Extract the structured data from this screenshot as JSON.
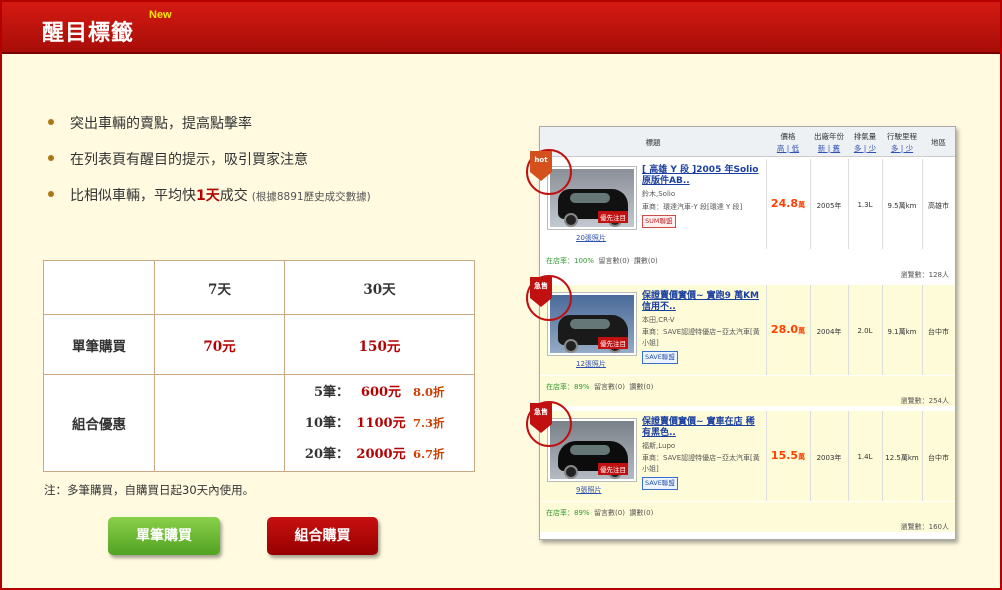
{
  "header": {
    "title": "醒目標籤",
    "new_badge": "New"
  },
  "bullets": [
    {
      "text": "突出車輛的賣點，提高點擊率"
    },
    {
      "text": "在列表頁有醒目的提示，吸引買家注意"
    },
    {
      "pre": "比相似車輛，平均快",
      "highlight": "1天",
      "post": "成交",
      "note": "(根據8891歷史成交數據)"
    }
  ],
  "pricing": {
    "col_7": "7天",
    "col_30": "30天",
    "single_label": "單筆購買",
    "single_7": "70元",
    "single_30": "150元",
    "combo_label": "組合優惠",
    "combos": [
      {
        "qty": "5筆：",
        "price": "600元",
        "discount": "8.0折"
      },
      {
        "qty": "10筆：",
        "price": "1100元",
        "discount": "7.3折"
      },
      {
        "qty": "20筆：",
        "price": "2000元",
        "discount": "6.7折"
      }
    ]
  },
  "note": "注：多筆購買，自購買日起30天內使用。",
  "buttons": {
    "single": "單筆購買",
    "combo": "組合購買"
  },
  "listing": {
    "headers": {
      "title": "標題",
      "price": "價格",
      "price_sort": "高 | 低",
      "year": "出廠年份",
      "year_sort": "新 | 舊",
      "disp": "排氣量",
      "disp_sort": "多 | 少",
      "mileage": "行駛里程",
      "mileage_sort": "多 | 少",
      "area": "地區"
    },
    "rows": [
      {
        "tag": "hot",
        "title": "[ 高雄 Y 段 ]2005 年Solio 原版件AB..",
        "model": "鈴木,Solio",
        "dealer": "車商：環達汽車-Y 段[環達 Y 段]",
        "badge": "SUM聯盟",
        "photos": "20張照片",
        "photo_tag": "優先注目",
        "price": "24.8",
        "unit": "萬",
        "year": "2005年",
        "disp": "1.3L",
        "mileage": "9.5萬km",
        "area": "高雄市",
        "foot_a": "在店率：100%",
        "foot_msg": "留言數(0)",
        "foot_fb": "讚數(0)",
        "views": "瀏覽數：128人"
      },
      {
        "tag": "急售",
        "title": "保證賣價實價~ 實跑9 萬KM 信用不..",
        "model": "本田,CR-V",
        "dealer": "車商：SAVE認證特優店~亞太汽車[黃小姐]",
        "badge": "SAVE聯盟",
        "photos": "12張照片",
        "photo_tag": "優先注目",
        "price": "28.0",
        "unit": "萬",
        "year": "2004年",
        "disp": "2.0L",
        "mileage": "9.1萬km",
        "area": "台中市",
        "foot_a": "在店率：89%",
        "foot_msg": "留言數(0)",
        "foot_fb": "讚數(0)",
        "views": "瀏覽數：254人"
      },
      {
        "tag": "急售",
        "title": "保證賣價實價~ 實車在店 稀有黑色..",
        "model": "福斯,Lupo",
        "dealer": "車商：SAVE認證特優店~亞太汽車[黃小姐]",
        "badge": "SAVE聯盟",
        "photos": "9張照片",
        "photo_tag": "優先注目",
        "price": "15.5",
        "unit": "萬",
        "year": "2003年",
        "disp": "1.4L",
        "mileage": "12.5萬km",
        "area": "台中市",
        "foot_a": "在店率：89%",
        "foot_msg": "留言數(0)",
        "foot_fb": "讚數(0)",
        "views": "瀏覽數：160人"
      }
    ]
  },
  "colors": {
    "brand_red": "#b40000",
    "green_button": "#52a222",
    "accent_orange": "#ff4000"
  }
}
